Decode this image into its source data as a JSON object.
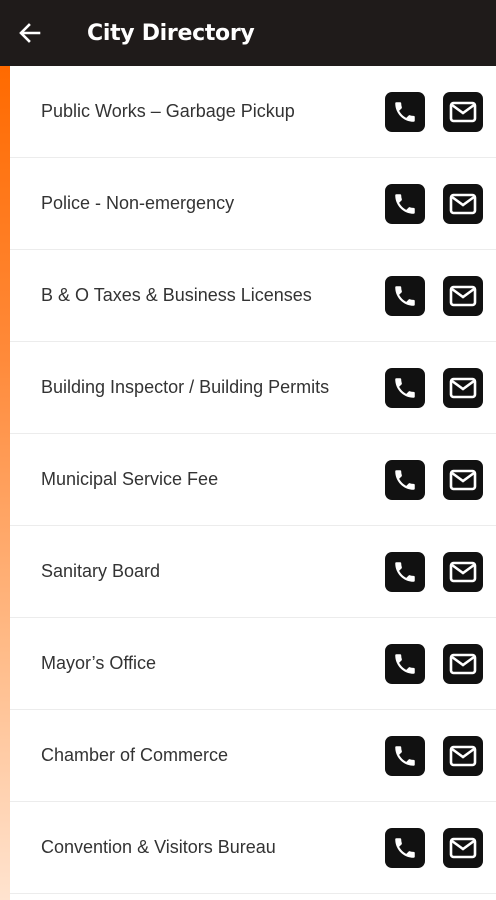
{
  "header": {
    "title": "City Directory",
    "back_icon": "arrow-left-icon"
  },
  "theme": {
    "header_bg": "#1f1b1a",
    "accent_top": "#ff6a00",
    "accent_bottom": "#ffe3cf",
    "action_bg": "#111111"
  },
  "directory": {
    "items": [
      {
        "label": "Public Works – Garbage Pickup",
        "call_icon": "phone-icon",
        "email_icon": "envelope-icon"
      },
      {
        "label": "Police - Non-emergency",
        "call_icon": "phone-icon",
        "email_icon": "envelope-icon"
      },
      {
        "label": "B & O Taxes & Business Licenses",
        "call_icon": "phone-icon",
        "email_icon": "envelope-icon"
      },
      {
        "label": "Building Inspector / Building Permits",
        "call_icon": "phone-icon",
        "email_icon": "envelope-icon"
      },
      {
        "label": "Municipal Service Fee",
        "call_icon": "phone-icon",
        "email_icon": "envelope-icon"
      },
      {
        "label": "Sanitary Board",
        "call_icon": "phone-icon",
        "email_icon": "envelope-icon"
      },
      {
        "label": "Mayor’s Office",
        "call_icon": "phone-icon",
        "email_icon": "envelope-icon"
      },
      {
        "label": "Chamber of Commerce",
        "call_icon": "phone-icon",
        "email_icon": "envelope-icon"
      },
      {
        "label": "Convention & Visitors Bureau",
        "call_icon": "phone-icon",
        "email_icon": "envelope-icon"
      }
    ]
  }
}
